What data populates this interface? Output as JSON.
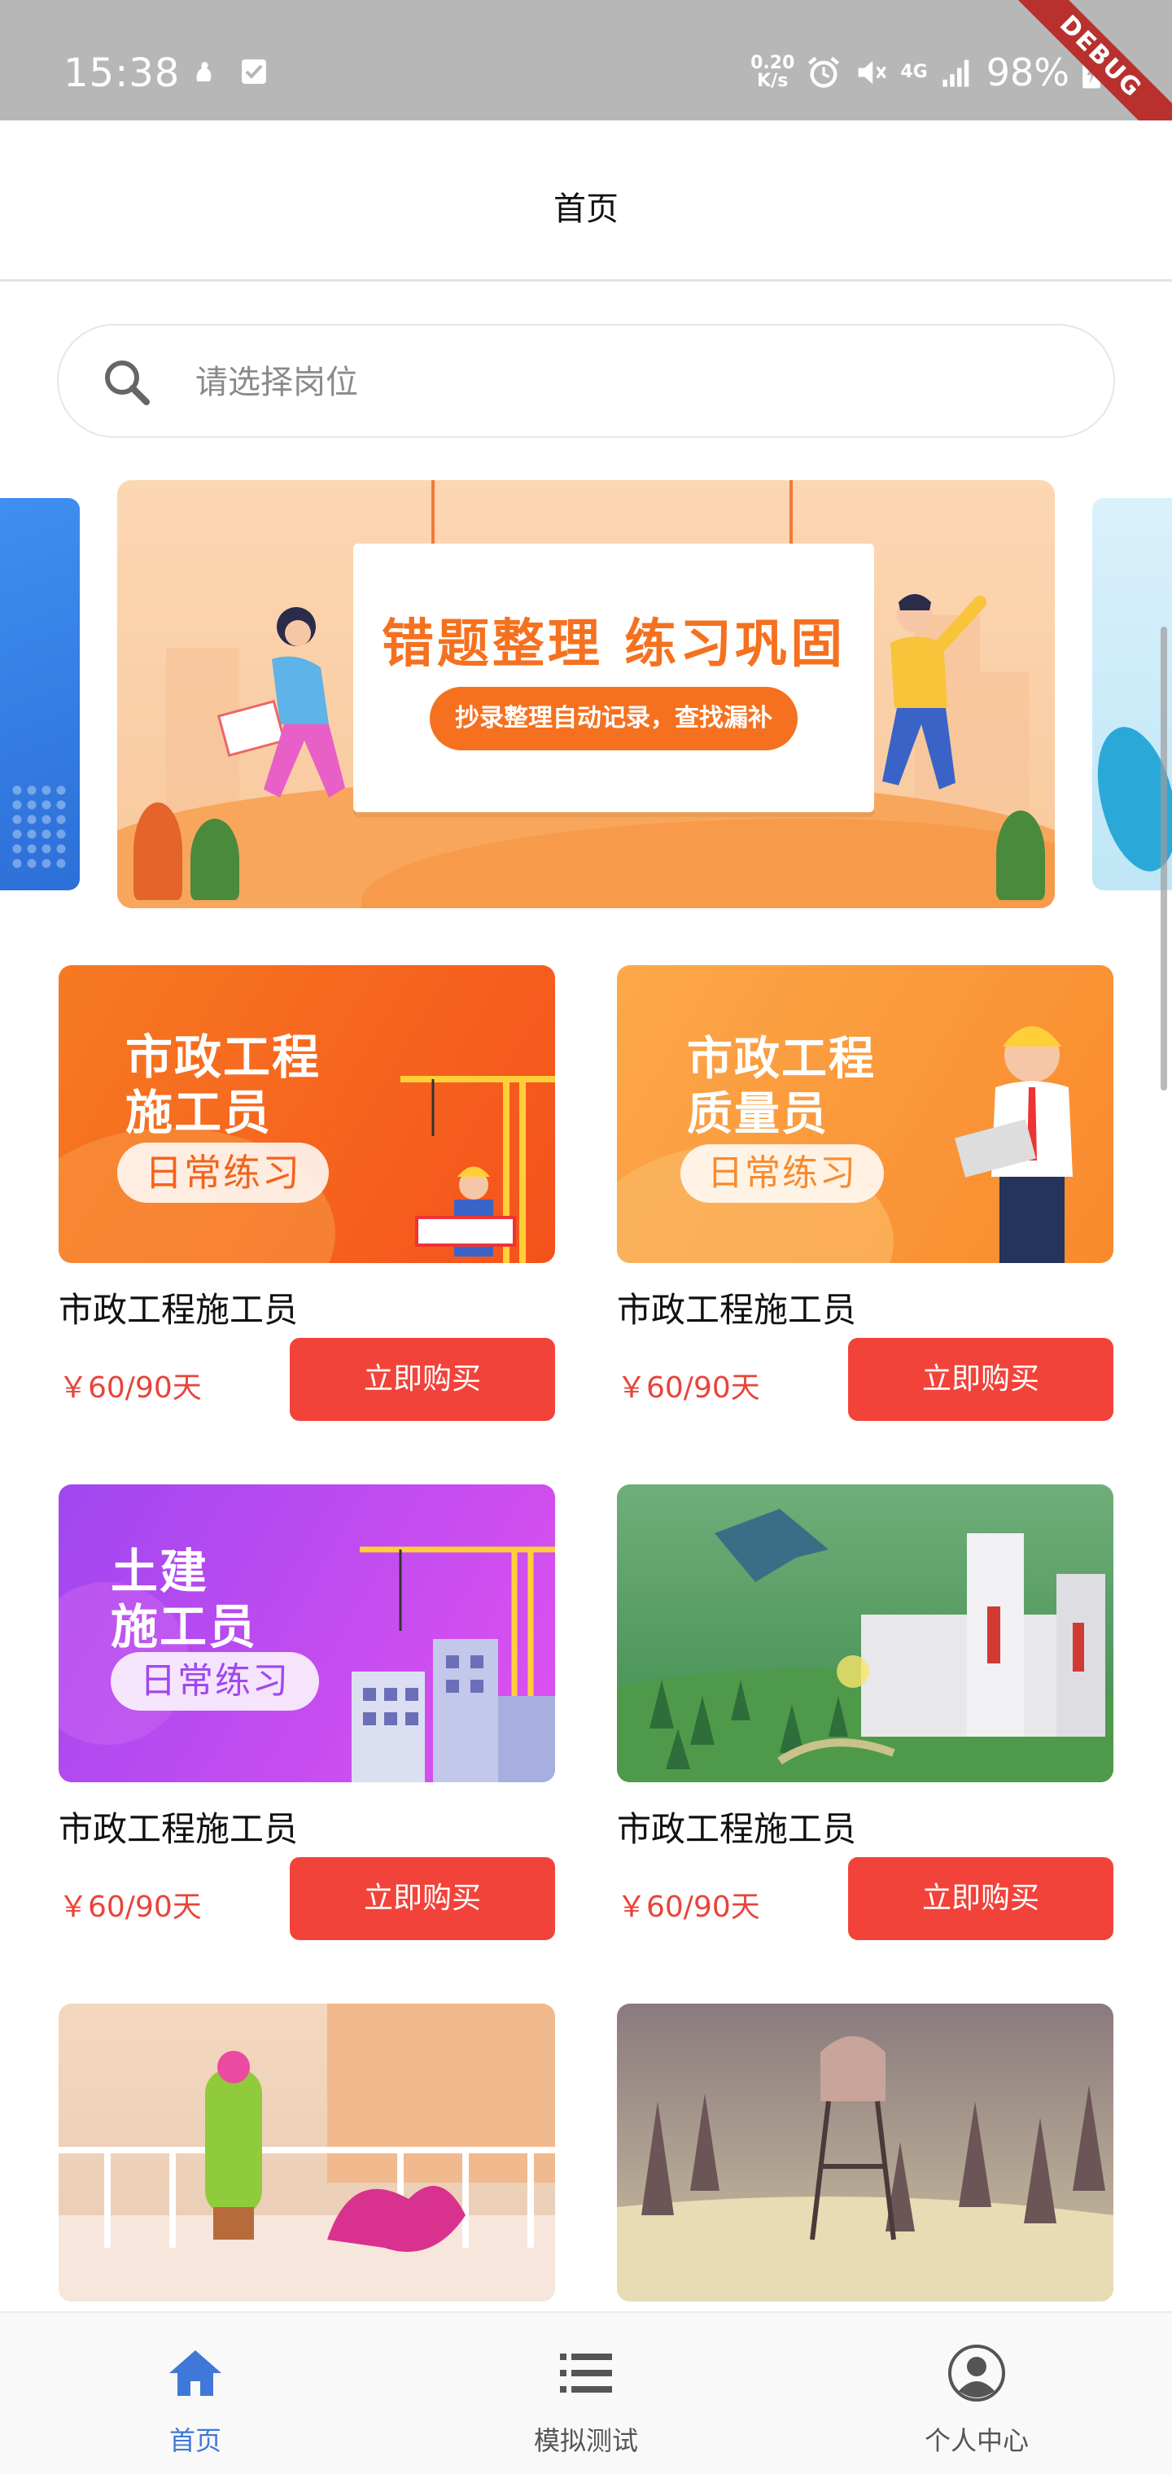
{
  "status_bar": {
    "time": "15:38",
    "net_speed_value": "0.20",
    "net_speed_unit": "K/s",
    "network": "4G",
    "battery": "98%",
    "debug_label": "DEBUG",
    "left_icons": [
      "notification-icon",
      "checkbox-icon"
    ],
    "right_icons": [
      "alarm-icon",
      "mute-icon",
      "signal-icon",
      "battery-charging-icon"
    ]
  },
  "header": {
    "title": "首页"
  },
  "search": {
    "placeholder": "请选择岗位"
  },
  "banner": {
    "headline": "错题整理  练习巩固",
    "subline": "抄录整理自动记录，查找漏补"
  },
  "products": [
    {
      "poster_line1": "市政工程",
      "poster_line2": "施工员",
      "poster_tag": "日常练习",
      "title": "市政工程施工员",
      "price": "￥60/90天",
      "button": "立即购买"
    },
    {
      "poster_line1": "市政工程",
      "poster_line2": "质量员",
      "poster_tag": "日常练习",
      "title": "市政工程施工员",
      "price": "￥60/90天",
      "button": "立即购买"
    },
    {
      "poster_line1": "土建",
      "poster_line2": "施工员",
      "poster_tag": "日常练习",
      "title": "市政工程施工员",
      "price": "￥60/90天",
      "button": "立即购买"
    },
    {
      "title": "市政工程施工员",
      "price": "￥60/90天",
      "button": "立即购买"
    }
  ],
  "bottom_nav": {
    "active": "home",
    "items": [
      {
        "label": "首页",
        "icon": "home-icon"
      },
      {
        "label": "模拟测试",
        "icon": "list-icon"
      },
      {
        "label": "个人中心",
        "icon": "user-icon"
      }
    ]
  },
  "colors": {
    "accent_red": "#f2433a",
    "price_red": "#e8443a",
    "nav_active_blue": "#3f78d8",
    "banner_orange": "#f5711f"
  }
}
